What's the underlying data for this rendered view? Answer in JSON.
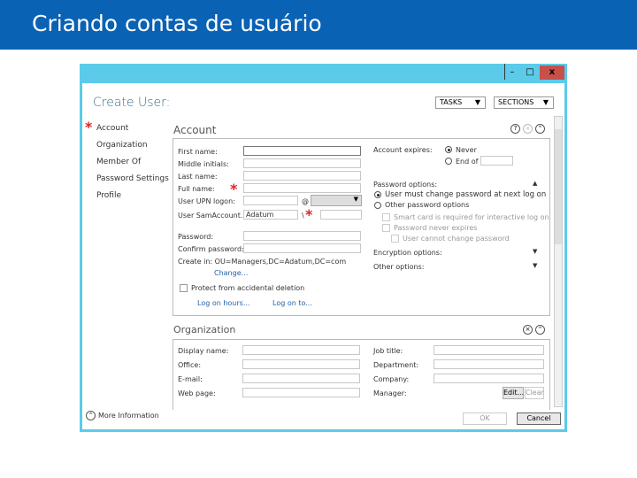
{
  "slide_title": "Criando contas de usuário",
  "window": {
    "minimize": "–",
    "maximize": "□",
    "close": "x"
  },
  "dialog": {
    "title": "Create User:",
    "tasks": "TASKS",
    "sections": "SECTIONS",
    "nav": [
      "Account",
      "Organization",
      "Member Of",
      "Password Settings",
      "Profile"
    ],
    "account": {
      "heading": "Account",
      "fields": [
        {
          "label": "First name:",
          "value": ""
        },
        {
          "label": "Middle initials:",
          "value": ""
        },
        {
          "label": "Last name:",
          "value": ""
        },
        {
          "label": "Full name:",
          "value": ""
        },
        {
          "label": "User UPN logon:",
          "value": ""
        },
        {
          "label": "User SamAccount...",
          "value": "Adatum"
        },
        {
          "label": "Password:",
          "value": ""
        },
        {
          "label": "Confirm password:",
          "value": ""
        }
      ],
      "upn_at": "@",
      "sam_sep": "\\",
      "create_in": "Create in: OU=Managers,DC=Adatum,DC=com",
      "change": "Change...",
      "protect": "Protect from accidental deletion",
      "logon_hours": "Log on hours...",
      "logon_to": "Log on to...",
      "account_expires": "Account expires:",
      "never": "Never",
      "end_of": "End of",
      "password_options": "Password options:",
      "must_change": "User must change password at next log on",
      "other_pw": "Other password options",
      "smart_card": "Smart card is required for interactive log on",
      "never_expires": "Password never expires",
      "cannot_change": "User cannot change password",
      "encryption": "Encryption options:",
      "other_options": "Other options:"
    },
    "organization": {
      "heading": "Organization",
      "left": [
        "Display name:",
        "Office:",
        "E-mail:",
        "Web page:"
      ],
      "right": [
        "Job title:",
        "Department:",
        "Company:",
        "Manager:"
      ],
      "edit": "Edit...",
      "clear": "Clear"
    },
    "more_info": "More Information",
    "ok": "OK",
    "cancel": "Cancel"
  }
}
